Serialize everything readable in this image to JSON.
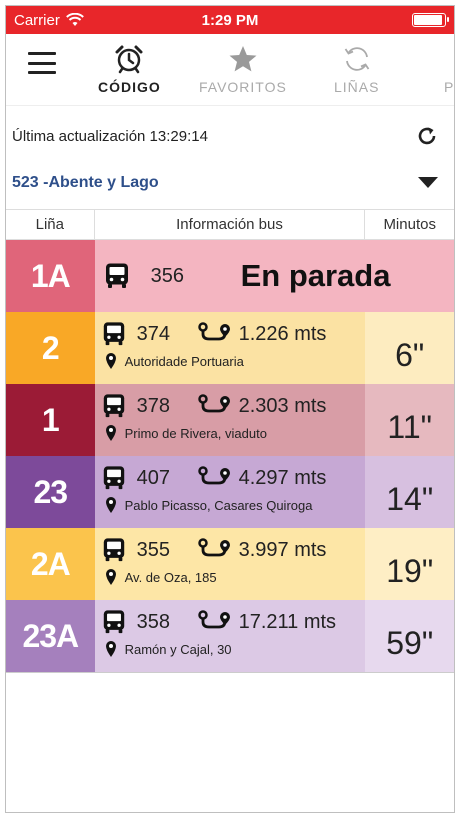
{
  "status_bar": {
    "carrier": "Carrier",
    "time": "1:29 PM",
    "battery_level": 0.95
  },
  "tabs": [
    {
      "label": "CÓDIGO",
      "icon": "alarm-clock-icon",
      "active": true
    },
    {
      "label": "FAVORITOS",
      "icon": "star-icon",
      "active": false
    },
    {
      "label": "LIÑAS",
      "icon": "refresh-cycle-icon",
      "active": false
    },
    {
      "label": "P",
      "icon": "",
      "active": false
    }
  ],
  "last_update": "Última actualización 13:29:14",
  "stop": "523 -Abente y Lago",
  "table": {
    "headers": {
      "line": "Liña",
      "info": "Información bus",
      "minutes": "Minutos"
    },
    "arriving": {
      "line": "1A",
      "bus": "356",
      "status": "En parada",
      "line_color": "#e0657a",
      "row_color": "#f4b5c1"
    },
    "rows": [
      {
        "line": "2",
        "bus": "374",
        "distance": "1.226 mts",
        "location": "Autoridade Portuaria",
        "minutes": "6\"",
        "line_color": "#f9a826",
        "row_color": "#fbe2a3",
        "min_color": "#fdecc0"
      },
      {
        "line": "1",
        "bus": "378",
        "distance": "2.303 mts",
        "location": "Primo de Rivera, viaduto",
        "minutes": "11\"",
        "line_color": "#9b1b36",
        "row_color": "#d89da6",
        "min_color": "#e6b9bf"
      },
      {
        "line": "23",
        "bus": "407",
        "distance": "4.297 mts",
        "location": "Pablo Picasso, Casares Quiroga",
        "minutes": "14\"",
        "line_color": "#7d4a9a",
        "row_color": "#c6a8d4",
        "min_color": "#d7c0e0"
      },
      {
        "line": "2A",
        "bus": "355",
        "distance": "3.997 mts",
        "location": "Av. de Oza, 185",
        "minutes": "19\"",
        "line_color": "#fbc44c",
        "row_color": "#fde6a6",
        "min_color": "#feeec5"
      },
      {
        "line": "23A",
        "bus": "358",
        "distance": "17.211 mts",
        "location": "Ramón y Cajal, 30",
        "minutes": "59\"",
        "line_color": "#a580bd",
        "row_color": "#dcc9e5",
        "min_color": "#e7d9ee"
      }
    ]
  }
}
